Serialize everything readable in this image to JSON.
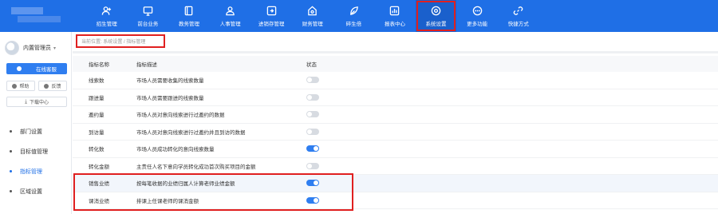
{
  "nav": [
    {
      "label": "招生管理",
      "icon": "user-add-icon"
    },
    {
      "label": "前台业务",
      "icon": "monitor-icon"
    },
    {
      "label": "教务管理",
      "icon": "book-icon"
    },
    {
      "label": "人事管理",
      "icon": "person-icon"
    },
    {
      "label": "进销存管理",
      "icon": "inventory-icon"
    },
    {
      "label": "财务管理",
      "icon": "finance-icon"
    },
    {
      "label": "碎生倍",
      "icon": "leaf-icon"
    },
    {
      "label": "报表中心",
      "icon": "report-icon"
    },
    {
      "label": "系统设置",
      "icon": "settings-icon",
      "active": true
    },
    {
      "label": "更多功能",
      "icon": "more-icon"
    },
    {
      "label": "快捷方式",
      "icon": "link-icon"
    }
  ],
  "user": {
    "name": "内置管理员"
  },
  "sidebar": {
    "online_label": "在线客服",
    "help_label": "帮助",
    "feedback_label": "反馈",
    "download_label": "下载中心",
    "menu": [
      {
        "label": "部门设置",
        "active": false
      },
      {
        "label": "目标值管理",
        "active": false
      },
      {
        "label": "指标管理",
        "active": true
      },
      {
        "label": "区域设置",
        "active": false
      }
    ]
  },
  "breadcrumb": "当前位置: 系统设置 / 指标管理",
  "table": {
    "headers": {
      "name": "指标名称",
      "desc": "指标描述",
      "status": "状态"
    },
    "rows": [
      {
        "name": "线索数",
        "desc": "市场人员需要收集的线索数量",
        "on": false
      },
      {
        "name": "跟进量",
        "desc": "市场人员需要跟进的线索数量",
        "on": false
      },
      {
        "name": "邀约量",
        "desc": "市场人员对意向线索进行过邀约的数据",
        "on": false
      },
      {
        "name": "到访量",
        "desc": "市场人员对意向线索进行过邀约并且到访的数据",
        "on": false
      },
      {
        "name": "转化数",
        "desc": "市场人员成功转化的意向线索数量",
        "on": true
      },
      {
        "name": "转化金额",
        "desc": "主责任人名下意向学员转化成功首次购买项目的金额",
        "on": false
      },
      {
        "name": "销售业绩",
        "desc": "按每笔收据的业绩归属人计算老师业绩金额",
        "on": true
      },
      {
        "name": "课消业绩",
        "desc": "排课上任课老师的课消金额",
        "on": true
      }
    ]
  },
  "colors": {
    "primary": "#1f6fe6",
    "highlight_border": "#e02020",
    "toggle_on": "#2f7ef0",
    "toggle_off": "#d7dbe1"
  }
}
